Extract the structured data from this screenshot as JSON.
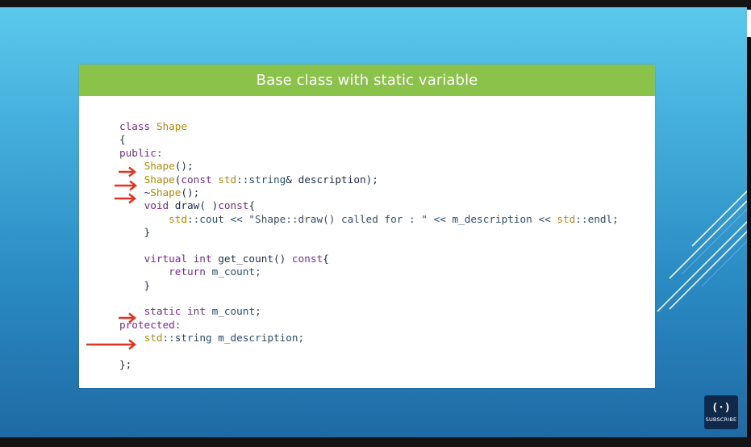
{
  "slide": {
    "title": "Base class with static variable"
  },
  "code": {
    "l01": [
      "class ",
      "Shape"
    ],
    "l02": "{",
    "l03": "public:",
    "l04": [
      "    ",
      "Shape",
      "();"
    ],
    "l05": [
      "    ",
      "Shape",
      "(",
      "const ",
      "std",
      "::",
      "string",
      "& description);"
    ],
    "l06": [
      "    ~",
      "Shape",
      "();"
    ],
    "l07": [
      "    ",
      "void ",
      "draw( )",
      "const",
      "{"
    ],
    "l08": [
      "        ",
      "std",
      "::cout << ",
      "\"Shape::draw() called for : \"",
      " << m_description << ",
      "std",
      "::endl;"
    ],
    "l09": "    }",
    "l10": "",
    "l11": [
      "    ",
      "virtual ",
      "int ",
      "get_count() ",
      "const",
      "{"
    ],
    "l12": [
      "        ",
      "return ",
      "m_count;"
    ],
    "l13": "    }",
    "l14": "",
    "l15": [
      "    ",
      "static ",
      "int ",
      "m_count;"
    ],
    "l16": "protected:",
    "l17": [
      "    ",
      "std",
      "::string m_description;"
    ],
    "l18": "",
    "l19": "};"
  },
  "annotations": {
    "arrow_color": "#e53222",
    "arrow_icon": "red-arrow-right"
  },
  "badge": {
    "logo": "(·)",
    "label": "SUBSCRIBE"
  },
  "colors": {
    "header_green": "#8bc34a",
    "keyword_purple": "#7a2a91",
    "type_gold": "#b58a0c",
    "background_blue": "#44aedb"
  }
}
